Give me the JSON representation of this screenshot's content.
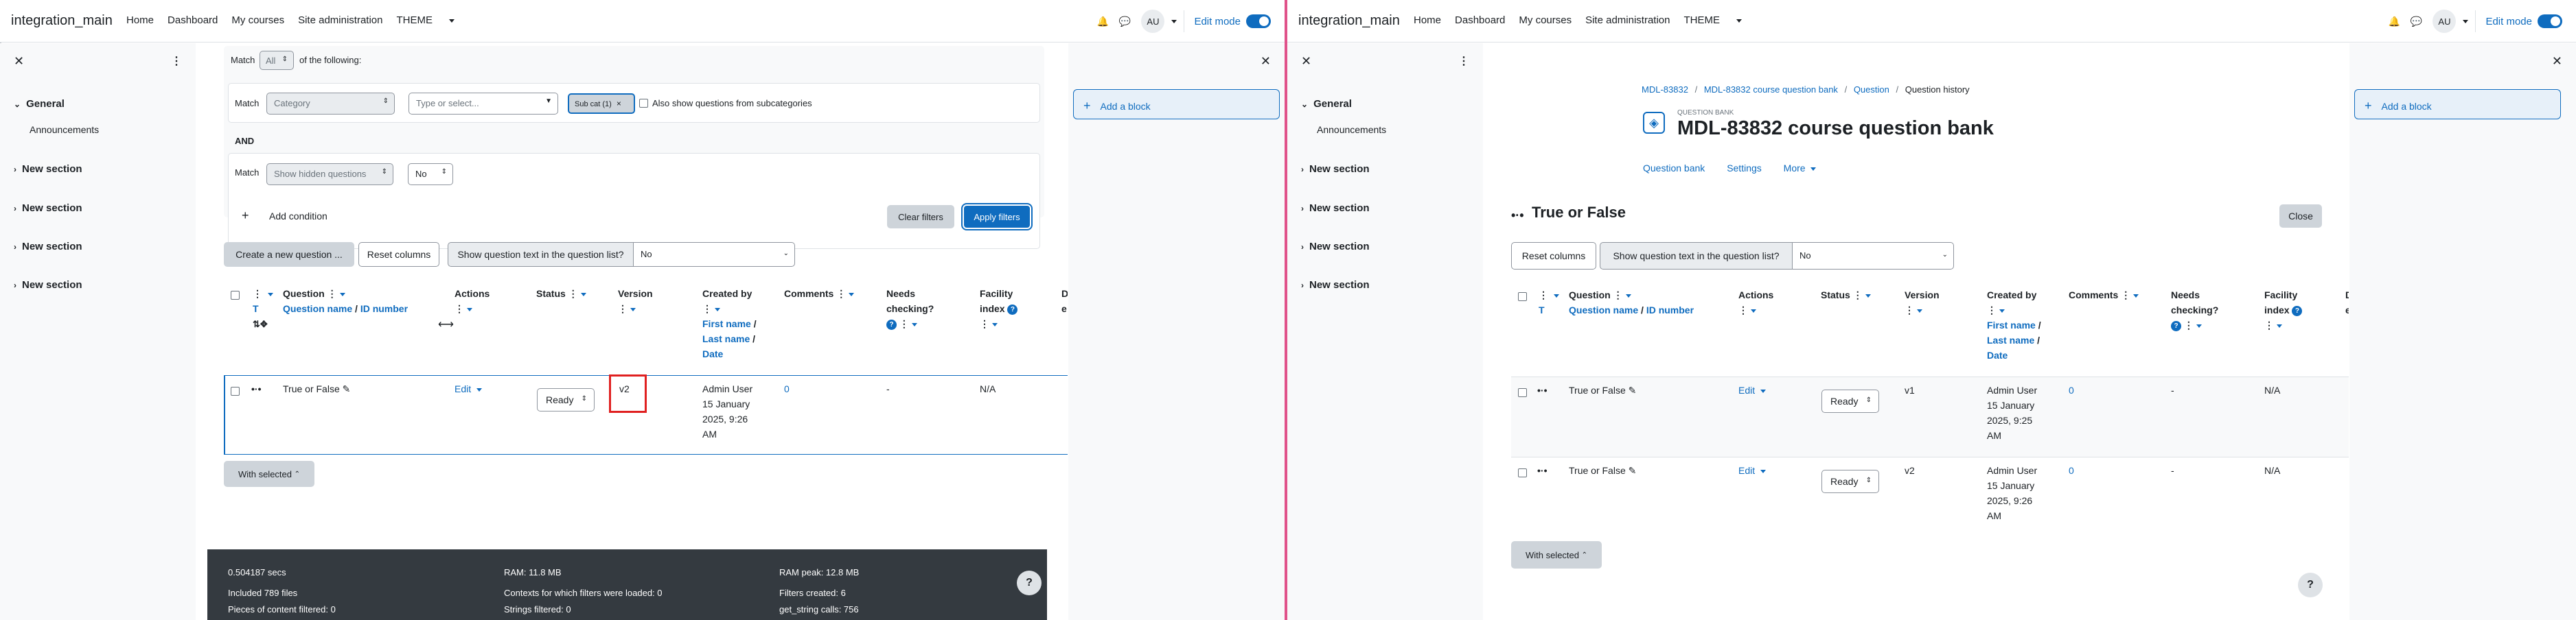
{
  "navbar": {
    "brand": "integration_main",
    "links": [
      "Home",
      "Dashboard",
      "My courses",
      "Site administration",
      "THEME"
    ],
    "avatar": "AU",
    "edit_mode": "Edit mode"
  },
  "drawer": {
    "sections": [
      "General",
      "New section",
      "New section",
      "New section",
      "New section"
    ],
    "general_item": "Announcements"
  },
  "block_drawer": {
    "add_block": "Add a block"
  },
  "left": {
    "match_label": "Match",
    "match_value": "All",
    "match_suffix": "of the following:",
    "cond1": {
      "label": "Match",
      "select": "Category",
      "search_placeholder": "Type or select...",
      "chip": "Sub cat (1)",
      "chip_close": "×",
      "subcat_label": "Also show questions from subcategories"
    },
    "and_label": "AND",
    "cond2": {
      "label": "Match",
      "select": "Show hidden questions",
      "value": "No"
    },
    "add_condition": "Add condition",
    "clear_filters": "Clear filters",
    "apply_filters": "Apply filters",
    "create_button": "Create a new question ...",
    "reset_columns": "Reset columns",
    "show_text_label": "Show question text in the question list?",
    "show_text_value": "No",
    "table": {
      "headers": {
        "t": "T",
        "question": "Question",
        "question_name": "Question name",
        "id_number": "ID number",
        "actions": "Actions",
        "status": "Status",
        "version": "Version",
        "created_by": "Created by",
        "first_name": "First name",
        "last_name": "Last name",
        "date": "Date",
        "comments": "Comments",
        "needs": "Needs checking?",
        "facility": "Facility index",
        "extra": "D e"
      },
      "row": {
        "name": "True or False",
        "action": "Edit",
        "status": "Ready",
        "version": "v2",
        "created": "Admin User 15 January 2025, 9:26 AM",
        "comments": "0",
        "needs": "-",
        "facility": "N/A"
      }
    },
    "with_selected": "With selected",
    "footer": {
      "secs": "0.504187 secs",
      "ram": "RAM: 11.8 MB",
      "ram_peak": "RAM peak: 12.8 MB",
      "files": "Included 789 files",
      "contexts": "Contexts for which filters were loaded: 0",
      "filters_created": "Filters created: 6",
      "pieces": "Pieces of content filtered: 0",
      "strings": "Strings filtered: 0",
      "get_string": "get_string calls: 756"
    }
  },
  "right": {
    "breadcrumb": [
      "MDL-83832",
      "MDL-83832 course question bank",
      "Question",
      "Question history"
    ],
    "bank_label": "QUESTION BANK",
    "title": "MDL-83832 course question bank",
    "tabs": [
      "Question bank",
      "Settings",
      "More"
    ],
    "history_title": "True or False",
    "close": "Close",
    "reset_columns": "Reset columns",
    "show_text_label": "Show question text in the question list?",
    "show_text_value": "No",
    "rows": [
      {
        "name": "True or False",
        "action": "Edit",
        "status": "Ready",
        "version": "v1",
        "created": "Admin User 15 January 2025, 9:25 AM",
        "comments": "0",
        "needs": "-",
        "facility": "N/A"
      },
      {
        "name": "True or False",
        "action": "Edit",
        "status": "Ready",
        "version": "v2",
        "created": "Admin User 15 January 2025, 9:26 AM",
        "comments": "0",
        "needs": "-",
        "facility": "N/A"
      }
    ],
    "with_selected": "With selected"
  },
  "icons": {
    "bell": "bell-icon",
    "chat": "chat-icon",
    "pencil": "pencil-icon",
    "help": "help-icon",
    "drag": "drag-icon"
  },
  "colors": {
    "accent": "#0f6cbf",
    "highlight": "#e02020",
    "divider": "#e0528a",
    "footer": "#343a40"
  }
}
